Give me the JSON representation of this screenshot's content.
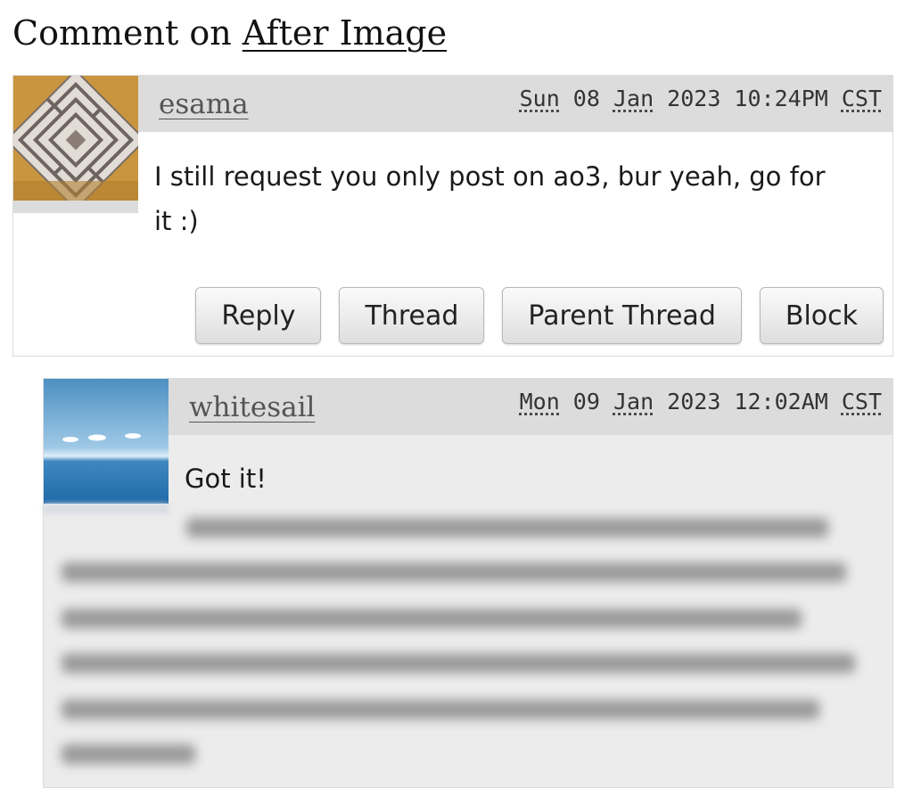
{
  "heading": {
    "prefix": "Comment on ",
    "link": "After Image"
  },
  "comments": [
    {
      "username": "esama",
      "date_day": "Sun",
      "date_rest": " 08 ",
      "date_month": "Jan",
      "date_tail": " 2023 10:24PM ",
      "tz": "CST",
      "body": "I still request you only post on ao3, bur yeah, go for it :)",
      "actions": [
        "Reply",
        "Thread",
        "Parent Thread",
        "Block"
      ]
    },
    {
      "username": "whitesail",
      "date_day": "Mon",
      "date_rest": " 09 ",
      "date_month": "Jan",
      "date_tail": " 2023 12:02AM ",
      "tz": "CST",
      "body": "Got it!"
    }
  ],
  "colors": {
    "header_bg": "#dcdcdc",
    "reply_bg": "#ececec"
  }
}
